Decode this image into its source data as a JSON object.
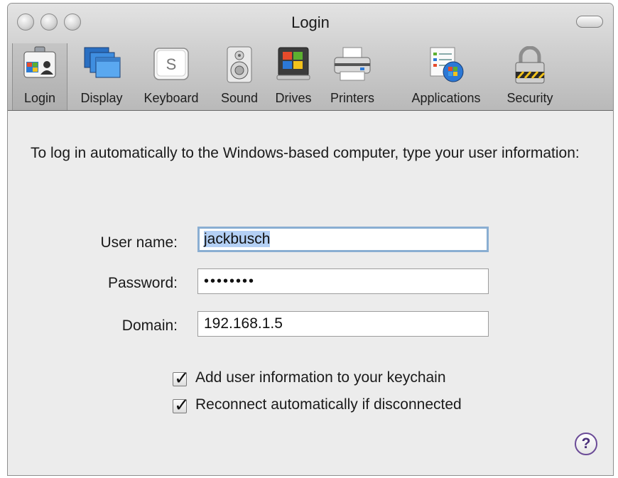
{
  "window": {
    "title": "Login"
  },
  "toolbar": {
    "items": [
      {
        "label": "Login",
        "icon": "login-id-badge-icon",
        "selected": true
      },
      {
        "label": "Display",
        "icon": "display-screens-icon",
        "selected": false
      },
      {
        "label": "Keyboard",
        "icon": "keyboard-key-icon",
        "selected": false
      },
      {
        "label": "Sound",
        "icon": "speaker-icon",
        "selected": false
      },
      {
        "label": "Drives",
        "icon": "drive-icon",
        "selected": false
      },
      {
        "label": "Printers",
        "icon": "printer-icon",
        "selected": false
      },
      {
        "label": "Applications",
        "icon": "applications-icon",
        "selected": false
      },
      {
        "label": "Security",
        "icon": "padlock-icon",
        "selected": false
      }
    ],
    "keyboard_key_glyph": "S"
  },
  "form": {
    "intro": "To log in automatically to the Windows-based computer, type your user information:",
    "username_label": "User name:",
    "username_value": "jackbusch",
    "password_label": "Password:",
    "password_value": "••••••••",
    "domain_label": "Domain:",
    "domain_value": "192.168.1.5",
    "keychain_label": "Add user information to your keychain",
    "keychain_checked": true,
    "reconnect_label": "Reconnect automatically if disconnected",
    "reconnect_checked": true,
    "checkmark_glyph": "✓"
  },
  "help": {
    "glyph": "?"
  },
  "colors": {
    "selection": "#b4d0f5",
    "focus_ring": "#8aaed2",
    "help_accent": "#6b4b97"
  }
}
